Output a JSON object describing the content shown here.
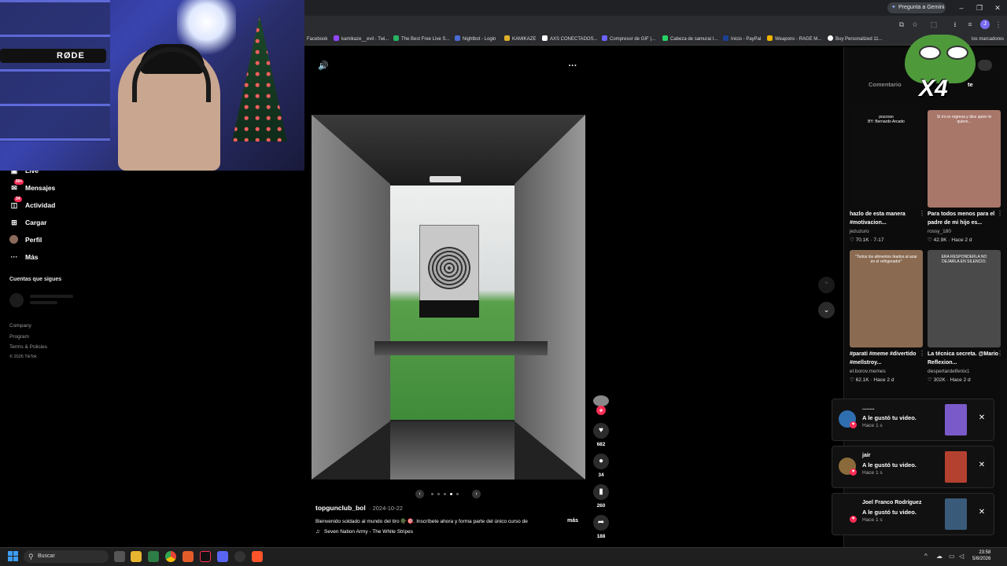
{
  "browser": {
    "gemini_label": "Pregunta a Gemini",
    "profile_initial": "J",
    "bookmarks": [
      {
        "label": "Facebook",
        "color": "#1877f2"
      },
      {
        "label": "kamikaze__evil - Twi...",
        "color": "#9146ff"
      },
      {
        "label": "The Best Free Live S...",
        "color": "#28b463"
      },
      {
        "label": "Nightbot - Login",
        "color": "#4b6bd6"
      },
      {
        "label": "KAMIKAZE",
        "color": "#e0b02a"
      },
      {
        "label": "AXS CONECTADOS...",
        "color": "#ffffff"
      },
      {
        "label": "Compresor de GIF |...",
        "color": "#6c63ff"
      },
      {
        "label": "Cabeza de samurai I...",
        "color": "#25d366"
      },
      {
        "label": "Inicio - PayPal",
        "color": "#1c3f94"
      },
      {
        "label": "Weapons - RAGE M...",
        "color": "#f0b400"
      },
      {
        "label": "Buy Personalized 11...",
        "color": "#ffffff"
      }
    ],
    "bookmarks_folder": "los marcadores"
  },
  "webcam": {
    "mic_brand": "RØDE"
  },
  "sidebar": {
    "items": [
      {
        "label": "Live",
        "icon": "live-icon"
      },
      {
        "label": "Mensajes",
        "icon": "messages-icon",
        "badge": "99+"
      },
      {
        "label": "Actividad",
        "icon": "activity-icon",
        "badge": "34"
      },
      {
        "label": "Cargar",
        "icon": "upload-icon"
      },
      {
        "label": "Perfil",
        "icon": "profile-icon"
      },
      {
        "label": "Más",
        "icon": "more-icon"
      }
    ],
    "following_title": "Cuentas que sigues",
    "footer": {
      "company": "Company",
      "program": "Program",
      "terms": "Terms & Policies",
      "copyright": "© 2026 TikTok"
    }
  },
  "post": {
    "author": "topgunclub_bol",
    "date": "· 2024-10-22",
    "caption": "Bienvenido soldado al mundo del tiro 🪖🎯. Inscríbete ahora y forma parte del único curso de",
    "more_label": "más",
    "music": "Seven Nation Army - The White Stripes",
    "photo_count": 5,
    "active_photo": 4,
    "likes": "682",
    "comments": "34",
    "saves": "260",
    "shares": "188"
  },
  "right_panel": {
    "tab_comments": "Comentario",
    "tab_creator": "te",
    "overlay_text": "X4",
    "videos": [
      {
        "title": "hazlo de esta manera #motivacion...",
        "user": "jezuzuro",
        "likes": "70.1K",
        "date": "7-17",
        "thumb_color": "#0d0d0d",
        "thumb_text": "pozzoso\nBY: Bernardo Arcado"
      },
      {
        "title": "Para todos menos para el padre de mi hijo es...",
        "user": "rossy_180",
        "likes": "42.9K",
        "date": "Hace 2 d",
        "thumb_color": "#a8776a",
        "thumb_text": "Si mi ex regresa y dice quien le quiere..."
      },
      {
        "title": "#parati #meme #divertido #mellstroy...",
        "user": "el.borov.memes",
        "likes": "62.1K",
        "date": "Hace 2 d",
        "thumb_color": "#8a6b52",
        "thumb_text": "\"Todos los alimentos tirados al azar en el refrigerador\""
      },
      {
        "title": "La técnica secreta. @Mario Reflexion...",
        "user": "despertardelfenix1",
        "likes": "302K",
        "date": "Hace 2 d",
        "thumb_color": "#4a4a4a",
        "thumb_text": "ERA RESPONDERLA NO DEJARLA EN SILENCIO."
      }
    ]
  },
  "notifications": [
    {
      "name": "........",
      "text": "A le gustó tu video.",
      "time": "Hace 1 s",
      "avatar_color": "#2f6fb0",
      "thumb_color": "#7a5ac9"
    },
    {
      "name": "jair",
      "text": "A le gustó tu video.",
      "time": "Hace 1 s",
      "avatar_color": "#8a6a3a",
      "thumb_color": "#b4412f"
    },
    {
      "name": "Joel Franco Rodríguez",
      "text": "A le gustó tu video.",
      "time": "Hace 1 s",
      "avatar_color": "#111111",
      "thumb_color": "#3a5a7a"
    }
  ],
  "taskbar": {
    "search_placeholder": "Buscar",
    "time": "23:58",
    "date": "5/8/2026"
  }
}
